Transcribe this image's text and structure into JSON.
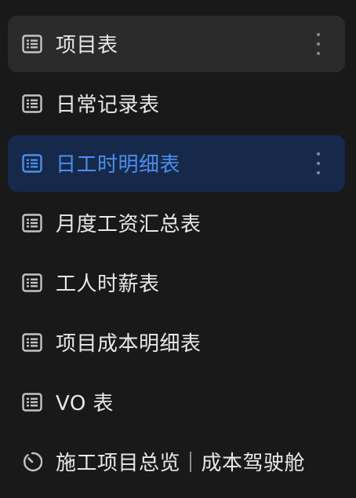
{
  "sidebar": {
    "items": [
      {
        "label": "项目表",
        "icon": "table-icon",
        "state": "hover",
        "has_more": true
      },
      {
        "label": "日常记录表",
        "icon": "table-icon",
        "state": "normal",
        "has_more": false
      },
      {
        "label": "日工时明细表",
        "icon": "table-icon",
        "state": "selected",
        "has_more": true
      },
      {
        "label": "月度工资汇总表",
        "icon": "table-icon",
        "state": "normal",
        "has_more": false
      },
      {
        "label": "工人时薪表",
        "icon": "table-icon",
        "state": "normal",
        "has_more": false
      },
      {
        "label": "项目成本明细表",
        "icon": "table-icon",
        "state": "normal",
        "has_more": false
      },
      {
        "label": "VO 表",
        "icon": "table-icon",
        "state": "normal",
        "has_more": false
      },
      {
        "label": "施工项目总览｜成本驾驶舱",
        "icon": "dashboard-gauge-icon",
        "state": "normal",
        "has_more": false
      }
    ]
  },
  "colors": {
    "background": "#191919",
    "hover_background": "#2b2b2b",
    "selected_background": "#16294a",
    "selected_text": "#4b8ef0",
    "text": "#e8e8e8",
    "icon": "#bdbdbd"
  }
}
